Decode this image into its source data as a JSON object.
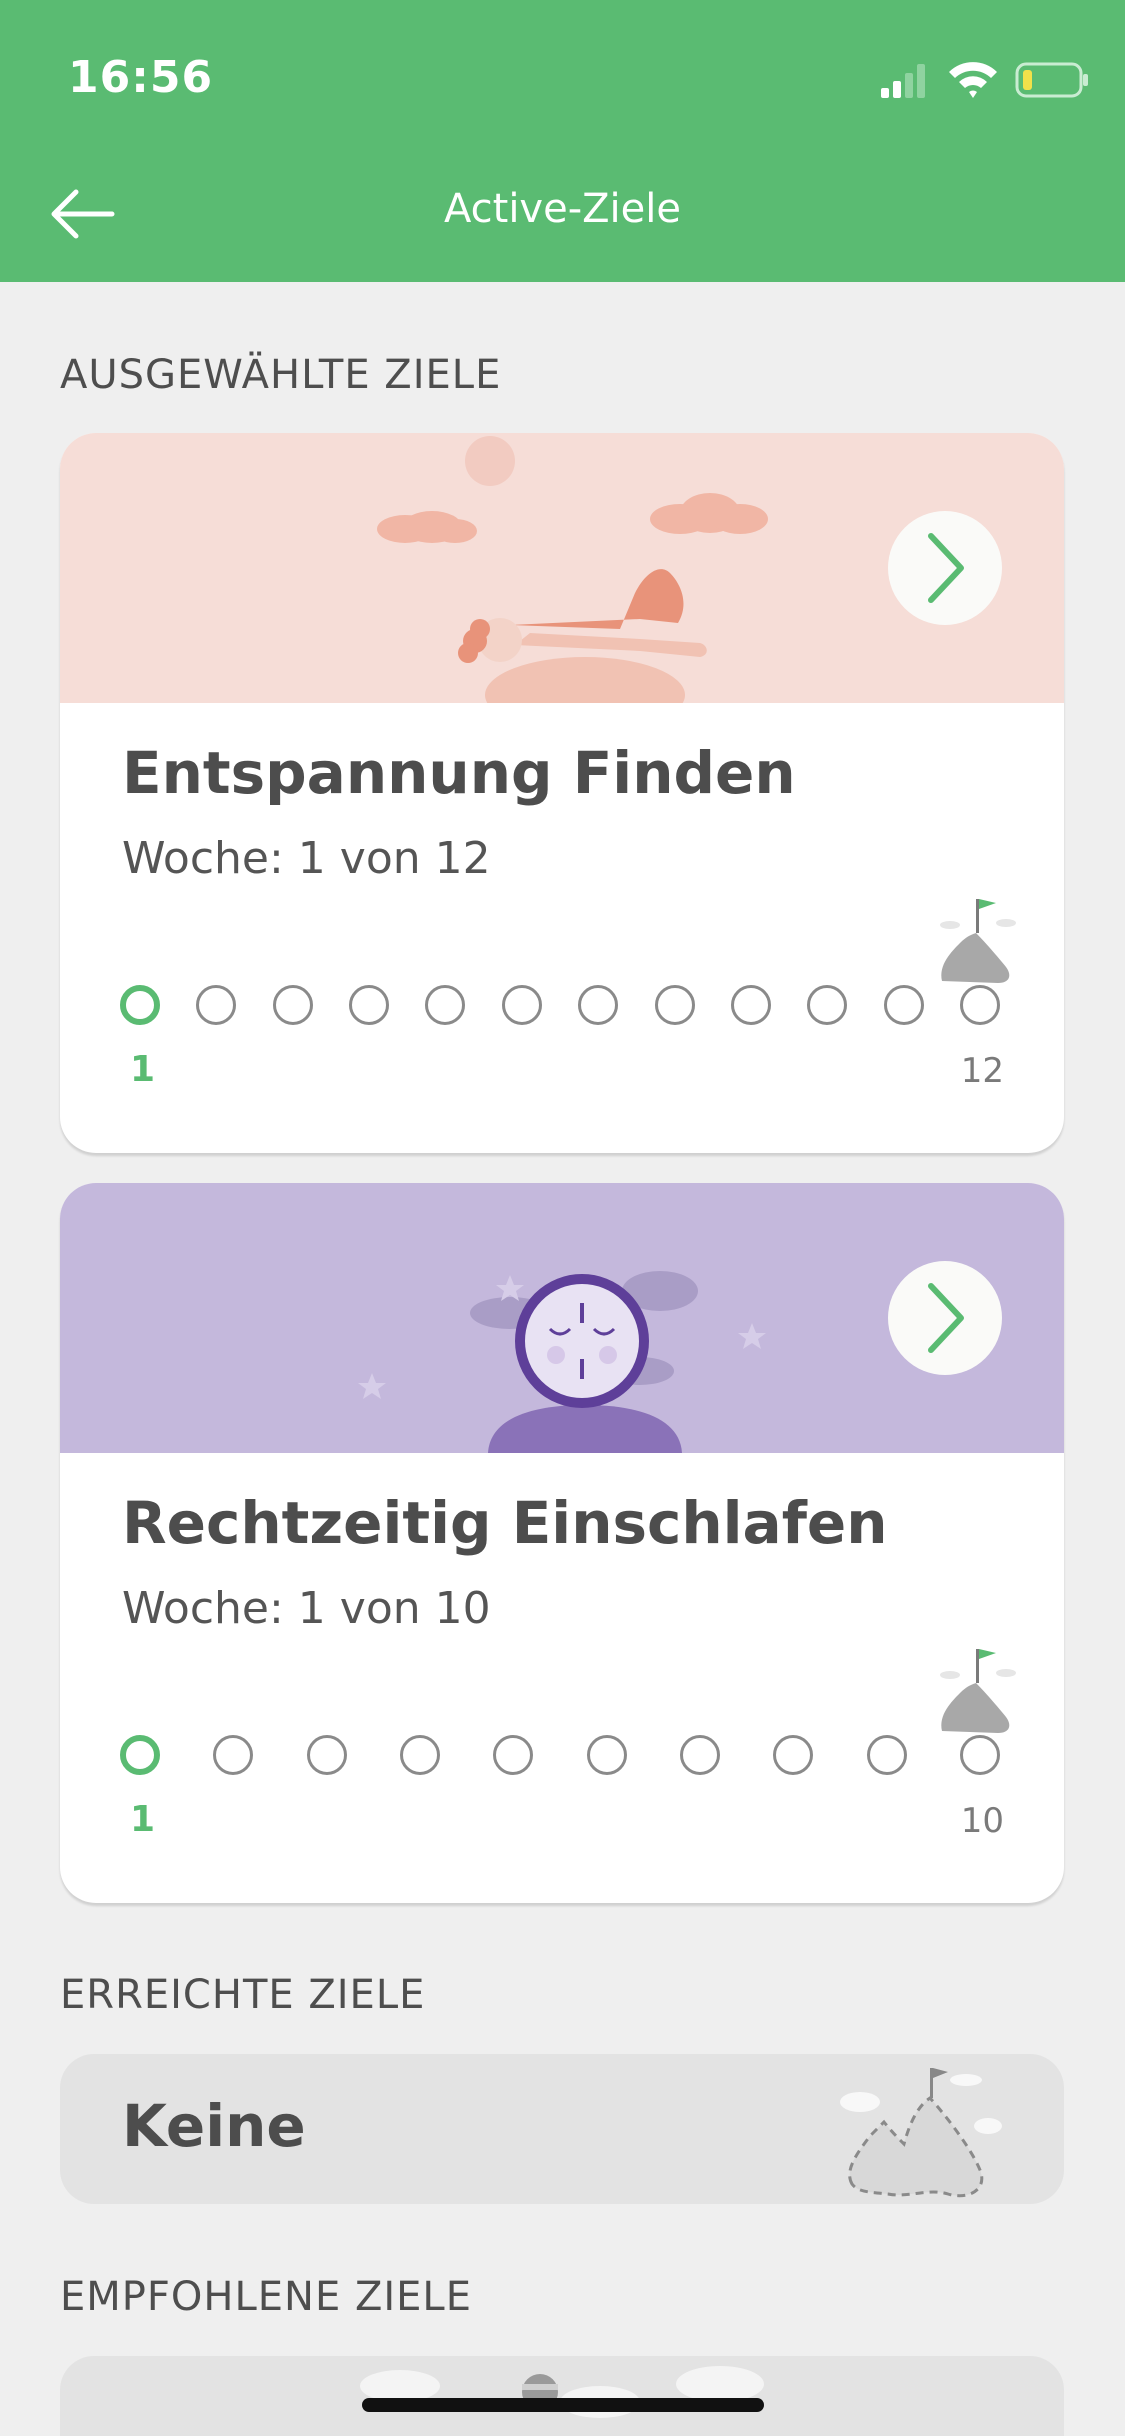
{
  "status_bar": {
    "time": "16:56"
  },
  "nav": {
    "title": "Active-Ziele"
  },
  "sections": {
    "selected": "AUSGEWÄHLTE ZIELE",
    "achieved": "ERREICHTE ZIELE",
    "recommended": "EMPFOHLENE ZIELE"
  },
  "goals": [
    {
      "title": "Entspannung Finden",
      "week": "Woche: 1 von 12",
      "start_label": "1",
      "end_label": "12",
      "hero_color": "#f6ddd7"
    },
    {
      "title": "Rechtzeitig Einschlafen",
      "week": "Woche: 1 von 10",
      "start_label": "1",
      "end_label": "10",
      "hero_color": "#c4b8dc"
    }
  ],
  "achieved": {
    "empty_text": "Keine"
  },
  "colors": {
    "accent": "#5abb72",
    "header": "#5abb72"
  }
}
